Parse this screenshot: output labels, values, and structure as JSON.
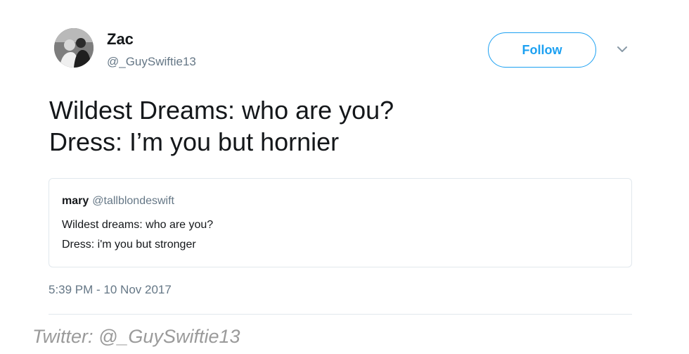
{
  "author": {
    "display_name": "Zac",
    "handle": "@_GuySwiftie13",
    "avatar_icon": "profile-photo"
  },
  "follow_button": {
    "label": "Follow"
  },
  "menu_icon": "chevron-down-icon",
  "tweet": {
    "lines": [
      "Wildest Dreams: who are you?",
      "Dress: I’m you but hornier"
    ],
    "timestamp": "5:39 PM - 10 Nov 2017"
  },
  "quoted_tweet": {
    "name": "mary",
    "handle": "@tallblondeswift",
    "lines": [
      "Wildest dreams: who are you?",
      "Dress: i'm you but stronger"
    ]
  },
  "credit": "Twitter: @_GuySwiftie13",
  "colors": {
    "accent": "#1da1f2",
    "text": "#14171a",
    "secondary": "#657786",
    "border": "#e1e8ed",
    "credit": "#9a9a9a"
  }
}
